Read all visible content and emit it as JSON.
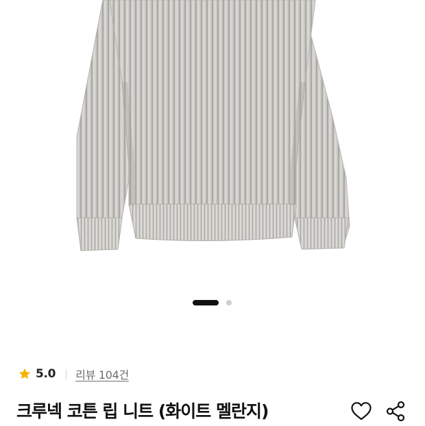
{
  "product": {
    "image_alt": "크루넥 코튼 립 니트",
    "gallery": {
      "total": 2,
      "current": 1
    },
    "rating": "5.0",
    "review_link": "리뷰 104건",
    "title": "크루넥 코튼 립 니트 (화이트 멜란지)"
  },
  "icons": {
    "star": "star-icon",
    "heart": "heart-icon",
    "share": "share-icon"
  },
  "colors": {
    "star": "#f6b400",
    "knit": "#c8c7c3",
    "text": "#111111",
    "muted": "#6d6d6d"
  }
}
